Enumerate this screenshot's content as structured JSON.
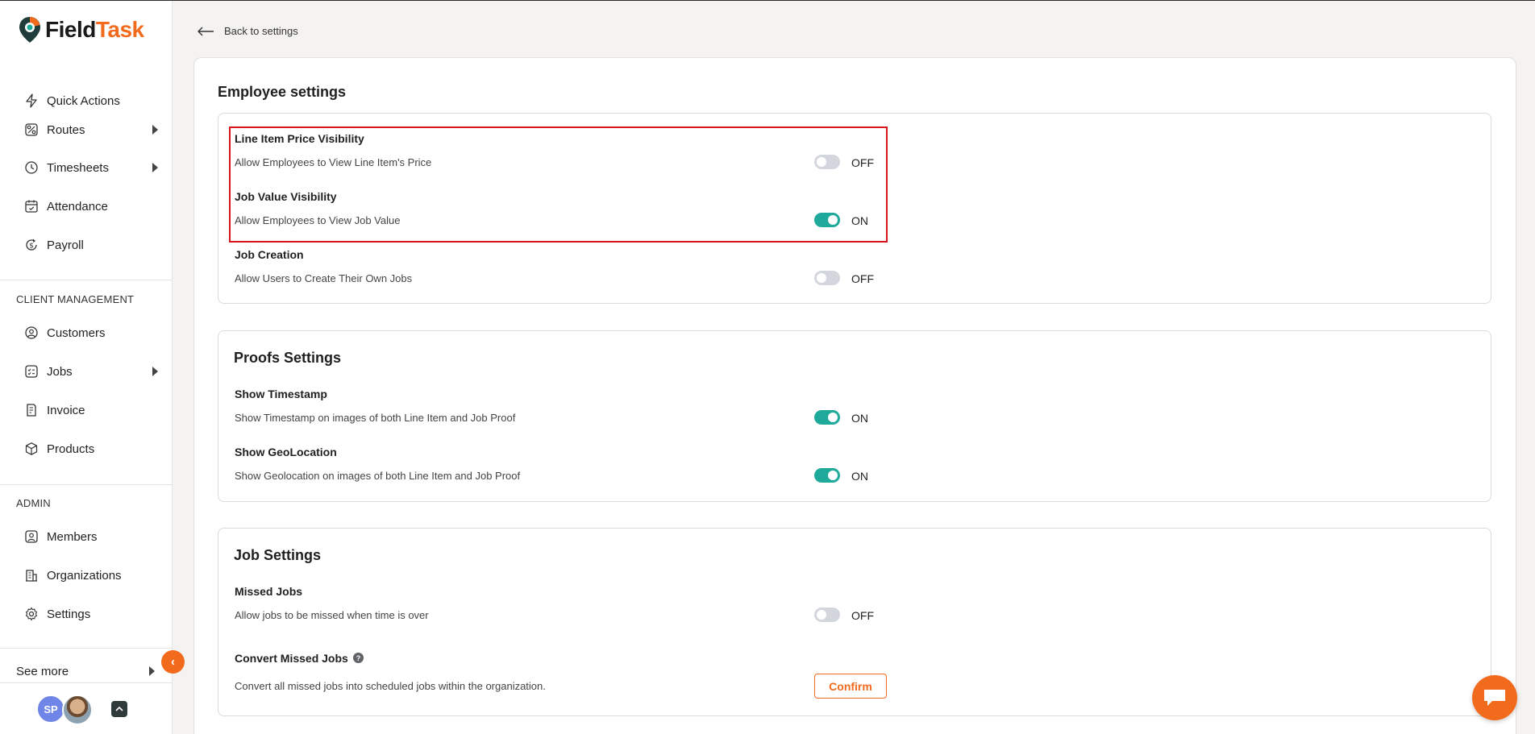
{
  "brand": {
    "name_part1": "Field",
    "name_part2": "Task",
    "accent": "#f26b1d"
  },
  "sidebar": {
    "items": [
      {
        "label": "Quick Actions",
        "icon": "lightning-icon"
      },
      {
        "label": "Routes",
        "icon": "route-icon",
        "expandable": true
      },
      {
        "label": "Timesheets",
        "icon": "clock-icon",
        "expandable": true
      },
      {
        "label": "Attendance",
        "icon": "calendar-check-icon"
      },
      {
        "label": "Payroll",
        "icon": "dollar-cycle-icon"
      }
    ],
    "client_section_label": "CLIENT MANAGEMENT",
    "client_items": [
      {
        "label": "Customers",
        "icon": "user-circle-icon"
      },
      {
        "label": "Jobs",
        "icon": "checklist-icon",
        "expandable": true
      },
      {
        "label": "Invoice",
        "icon": "invoice-icon"
      },
      {
        "label": "Products",
        "icon": "box-icon"
      }
    ],
    "admin_section_label": "ADMIN",
    "admin_items": [
      {
        "label": "Members",
        "icon": "user-square-icon"
      },
      {
        "label": "Organizations",
        "icon": "building-icon"
      },
      {
        "label": "Settings",
        "icon": "gear-icon"
      }
    ],
    "see_more": "See more",
    "user_initials": "SP"
  },
  "main": {
    "back_label": "Back to settings",
    "panel_title": "Employee settings",
    "employee_settings": [
      {
        "title": "Line Item Price Visibility",
        "description": "Allow Employees to View Line Item's Price",
        "state": "OFF"
      },
      {
        "title": "Job Value Visibility",
        "description": "Allow Employees to View Job Value",
        "state": "ON"
      },
      {
        "title": "Job Creation",
        "description": "Allow Users to Create Their Own Jobs",
        "state": "OFF"
      }
    ],
    "proofs": {
      "title": "Proofs Settings",
      "settings": [
        {
          "title": "Show Timestamp",
          "description": "Show Timestamp on images of both Line Item and Job Proof",
          "state": "ON"
        },
        {
          "title": "Show GeoLocation",
          "description": "Show Geolocation on images of both Line Item and Job Proof",
          "state": "ON"
        }
      ]
    },
    "jobs": {
      "title": "Job Settings",
      "missed": {
        "title": "Missed Jobs",
        "description": "Allow jobs to be missed when time is over",
        "state": "OFF"
      },
      "convert": {
        "title": "Convert Missed Jobs",
        "description": "Convert all missed jobs into scheduled jobs within the organization.",
        "button": "Confirm",
        "help": "?"
      }
    }
  },
  "colors": {
    "toggle_on": "#1fa99a",
    "toggle_off": "#d3d6dc",
    "highlight": "#d9141a"
  }
}
